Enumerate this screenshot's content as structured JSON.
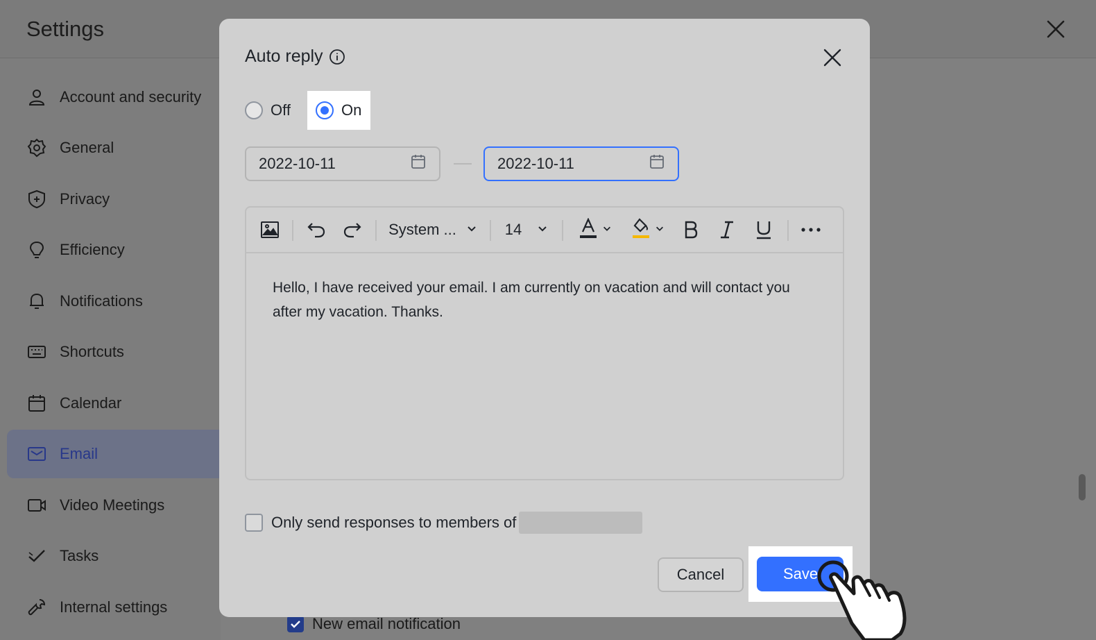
{
  "settings": {
    "title": "Settings",
    "sidebar": {
      "items": [
        {
          "label": "Account and security",
          "icon": "person-icon"
        },
        {
          "label": "General",
          "icon": "gear-icon"
        },
        {
          "label": "Privacy",
          "icon": "shield-icon"
        },
        {
          "label": "Efficiency",
          "icon": "lightbulb-icon"
        },
        {
          "label": "Notifications",
          "icon": "bell-icon"
        },
        {
          "label": "Shortcuts",
          "icon": "keyboard-icon"
        },
        {
          "label": "Calendar",
          "icon": "calendar-icon"
        },
        {
          "label": "Email",
          "icon": "mail-icon",
          "active": true
        },
        {
          "label": "Video Meetings",
          "icon": "video-camera-icon"
        },
        {
          "label": "Tasks",
          "icon": "check-icon"
        },
        {
          "label": "Internal settings",
          "icon": "wrench-icon"
        }
      ]
    },
    "background": {
      "new_email_notification_label": "New email notification",
      "new_email_notification_checked": true
    }
  },
  "modal": {
    "title": "Auto reply",
    "auto_reply": {
      "off_label": "Off",
      "on_label": "On",
      "selected": "On"
    },
    "start_date": "2022-10-11",
    "end_date": "2022-10-11",
    "toolbar": {
      "font_family": "System ...",
      "font_size": "14",
      "text_color": "#1f2329",
      "highlight_color": "#f5b800"
    },
    "message": "Hello, I have received your email. I am currently on vacation and will contact you after my vacation. Thanks.",
    "only_send_label": "Only send responses to members of",
    "only_send_checked": false,
    "cancel_label": "Cancel",
    "save_label": "Save"
  },
  "colors": {
    "accent": "#3370ff",
    "active_sidebar_text": "#28388a"
  }
}
